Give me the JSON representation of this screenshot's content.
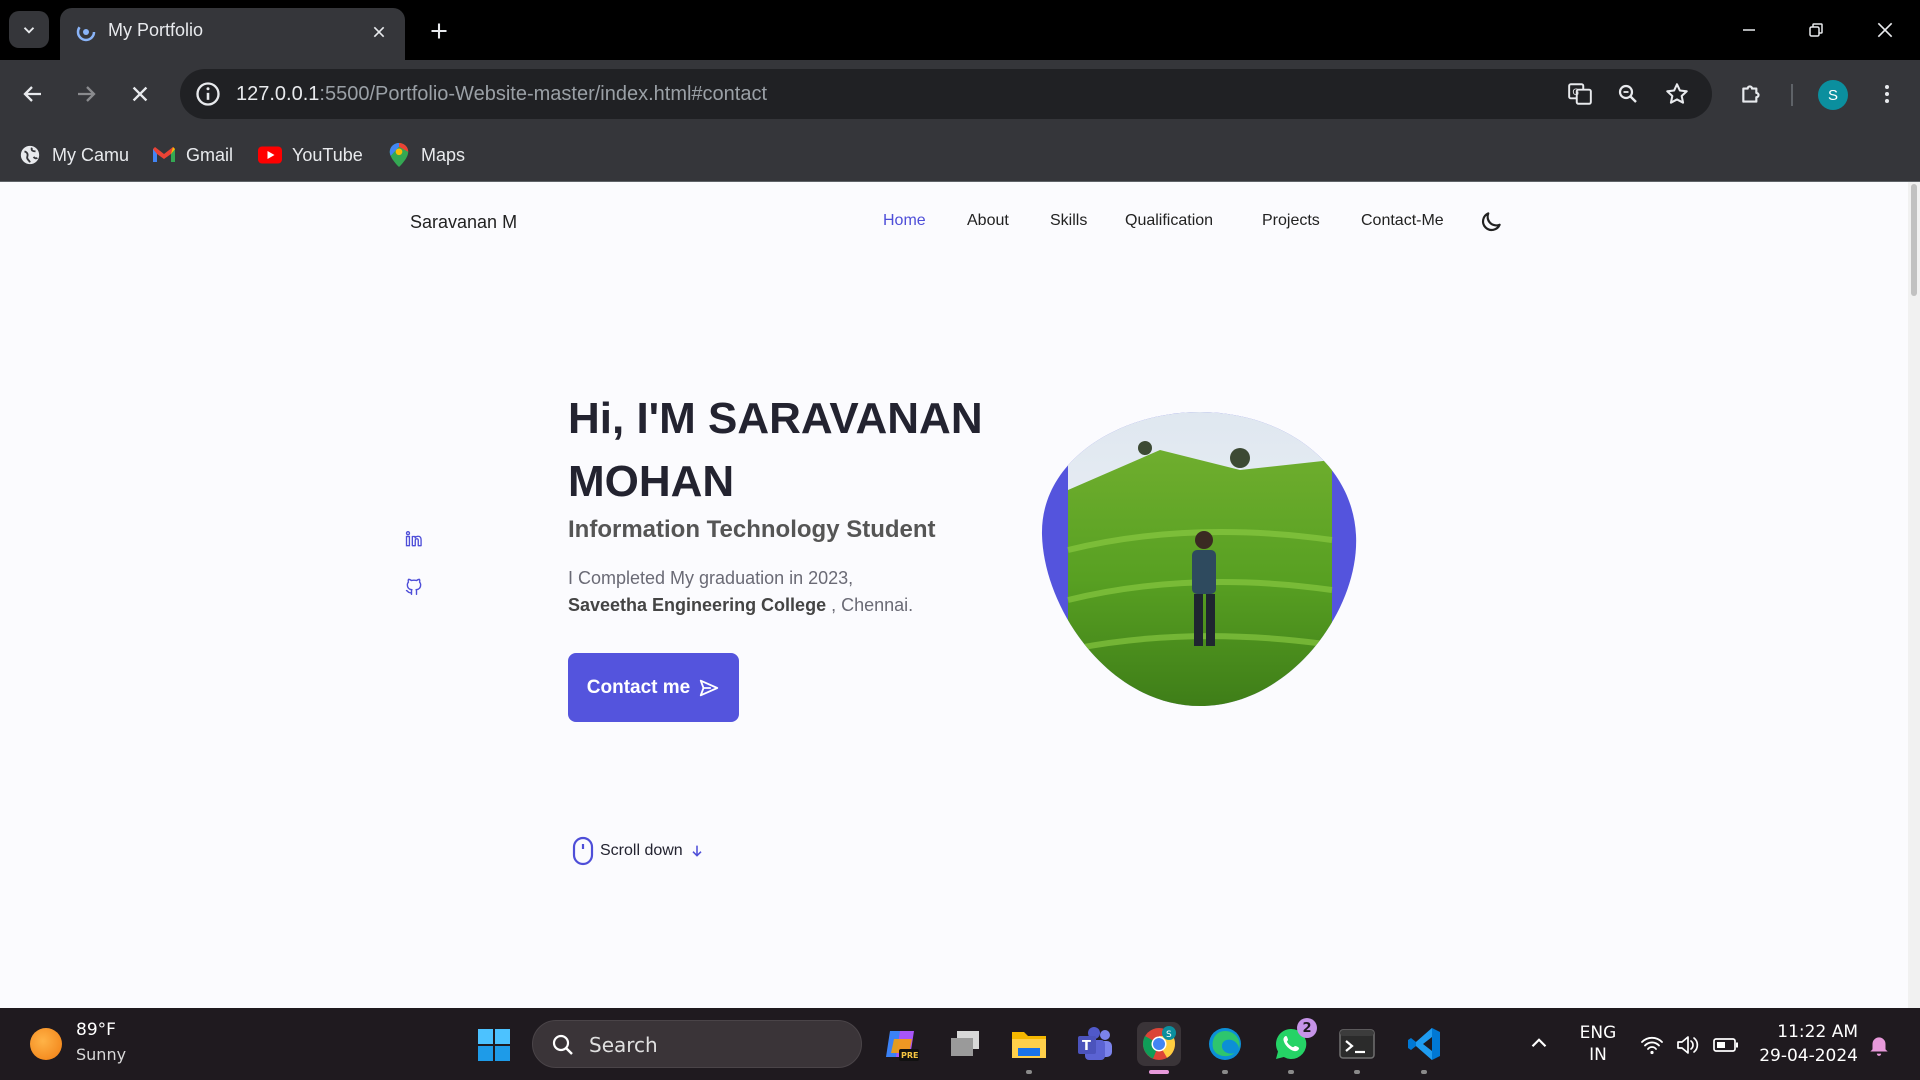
{
  "browser": {
    "tab_title": "My Portfolio",
    "url_host": "127.0.0.1",
    "url_rest": ":5500/Portfolio-Website-master/index.html#contact",
    "profile_initial": "S",
    "bookmarks": [
      {
        "label": "My Camu",
        "icon": "globe-icon"
      },
      {
        "label": "Gmail",
        "icon": "gmail-icon"
      },
      {
        "label": "YouTube",
        "icon": "youtube-icon"
      },
      {
        "label": "Maps",
        "icon": "maps-icon"
      }
    ]
  },
  "site": {
    "logo": "Saravanan M",
    "nav": [
      "Home",
      "About",
      "Skills",
      "Qualification",
      "Projects",
      "Contact-Me"
    ],
    "active_nav": "Home",
    "hero": {
      "title": "Hi, I'M SARAVANAN MOHAN",
      "subtitle": "Information Technology Student",
      "desc_line1": "I Completed My graduation in 2023,",
      "college": "Saveetha Engineering College",
      "desc_city": " , Chennai.",
      "button": "Contact me",
      "scroll": "Scroll down"
    },
    "accent": "#5454dd"
  },
  "taskbar": {
    "temp": "89°F",
    "condition": "Sunny",
    "search_placeholder": "Search",
    "whatsapp_badge": "2",
    "lang_top": "ENG",
    "lang_bottom": "IN",
    "time": "11:22 AM",
    "date": "29-04-2024"
  }
}
